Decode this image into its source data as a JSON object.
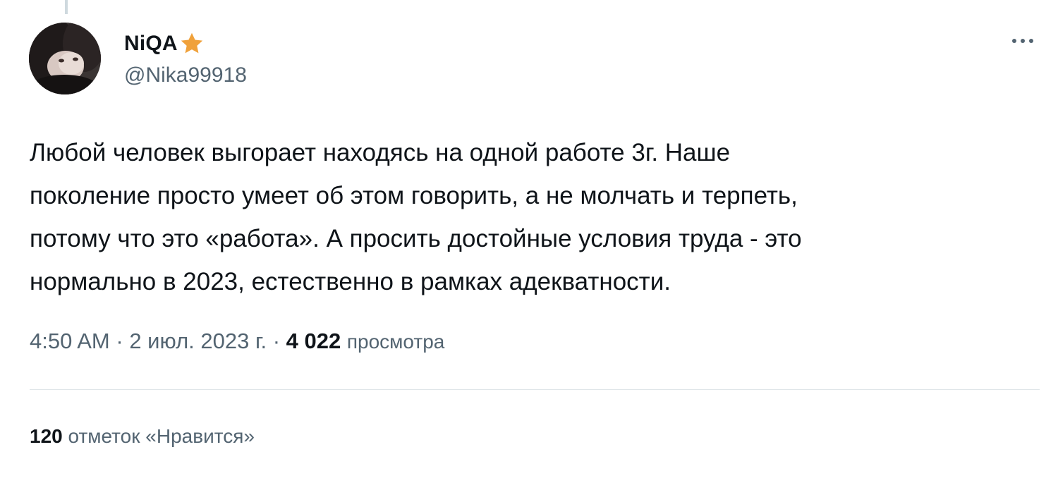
{
  "author": {
    "display_name": "NiQA",
    "handle": "@Nika99918",
    "badge_icon": "star-icon",
    "badge_color": "#f0a13a"
  },
  "tweet": {
    "text_lines": [
      "Любой человек выгорает находясь на одной работе 3г. Наше",
      "поколение просто умеет об этом говорить, а не молчать и терпеть,",
      "потому что это «работа». А просить достойные условия труда - это",
      "нормально в 2023, естественно в рамках адекватности."
    ]
  },
  "meta": {
    "time": "4:50 AM",
    "separator": "·",
    "date": "2 июл. 2023 г.",
    "views_count": "4 022",
    "views_label": "просмотра"
  },
  "engagement": {
    "likes_count": "120",
    "likes_label": "отметок «Нравится»"
  },
  "icons": {
    "more": "more-horizontal-icon"
  },
  "colors": {
    "text_primary": "#0f1419",
    "text_secondary": "#536471",
    "divider": "#dfe5e8"
  }
}
